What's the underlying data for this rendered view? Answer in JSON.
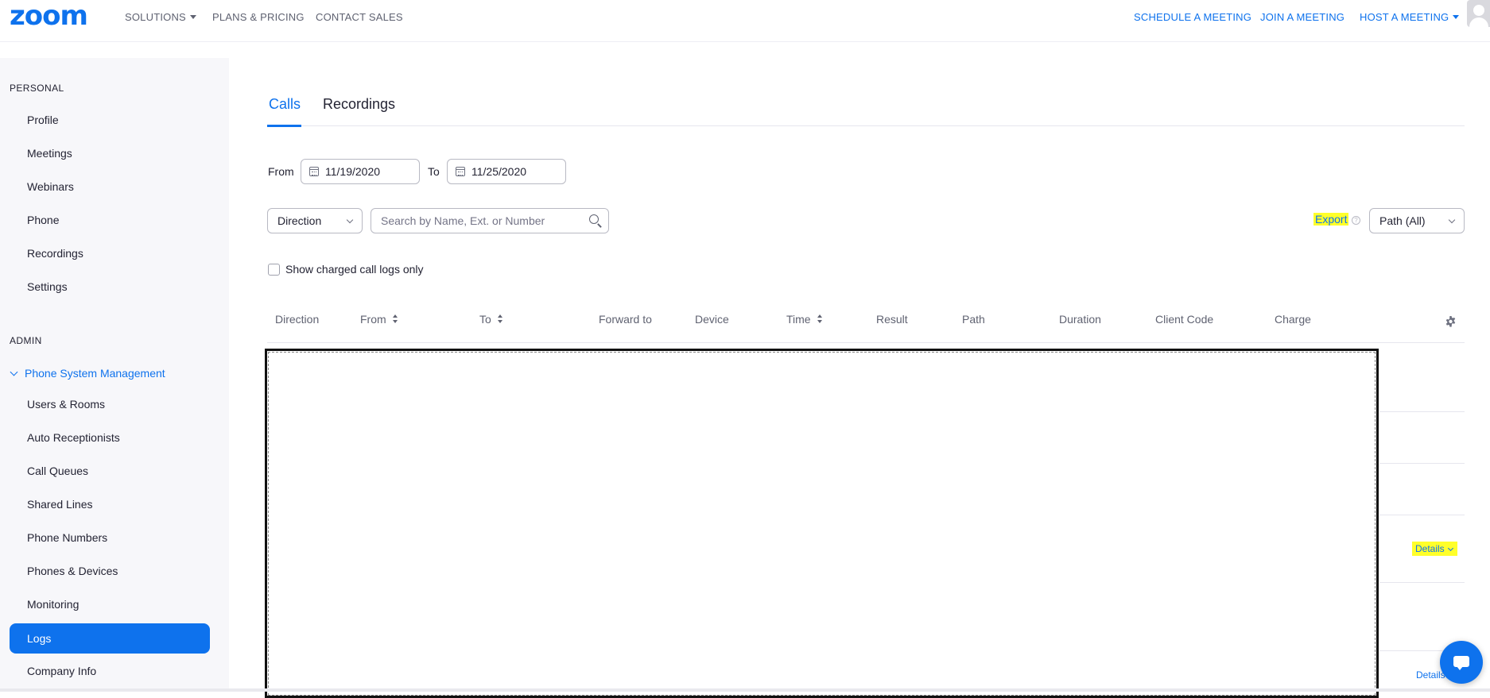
{
  "header": {
    "logo": "zoom",
    "nav_left": [
      "SOLUTIONS",
      "PLANS & PRICING",
      "CONTACT SALES"
    ],
    "nav_right": [
      "SCHEDULE A MEETING",
      "JOIN A MEETING",
      "HOST A MEETING"
    ]
  },
  "sidebar": {
    "personal_title": "PERSONAL",
    "personal_items": [
      "Profile",
      "Meetings",
      "Webinars",
      "Phone",
      "Recordings",
      "Settings"
    ],
    "admin_title": "ADMIN",
    "admin_group": "Phone System Management",
    "admin_items": [
      "Users & Rooms",
      "Auto Receptionists",
      "Call Queues",
      "Shared Lines",
      "Phone Numbers",
      "Phones & Devices",
      "Monitoring",
      "Logs",
      "Company Info"
    ],
    "active_item": "Logs"
  },
  "tabs": {
    "calls": "Calls",
    "recordings": "Recordings",
    "active": "Calls"
  },
  "filters": {
    "from_label": "From",
    "from_date": "11/19/2020",
    "to_label": "To",
    "to_date": "11/25/2020",
    "direction_select": "Direction",
    "search_placeholder": "Search by Name, Ext. or Number",
    "export_label": "Export",
    "path_select": "Path (All)",
    "charged_only_label": "Show charged call logs only",
    "charged_only_checked": false
  },
  "table": {
    "columns": [
      "Direction",
      "From",
      "To",
      "Forward to",
      "Device",
      "Time",
      "Result",
      "Path",
      "Duration",
      "Client Code",
      "Charge"
    ],
    "sortable": [
      "From",
      "To",
      "Time"
    ],
    "details_label": "Details"
  },
  "colors": {
    "accent": "#0e72ed",
    "highlight": "#ffff2a",
    "sidebar_bg": "#f7f7fa"
  }
}
